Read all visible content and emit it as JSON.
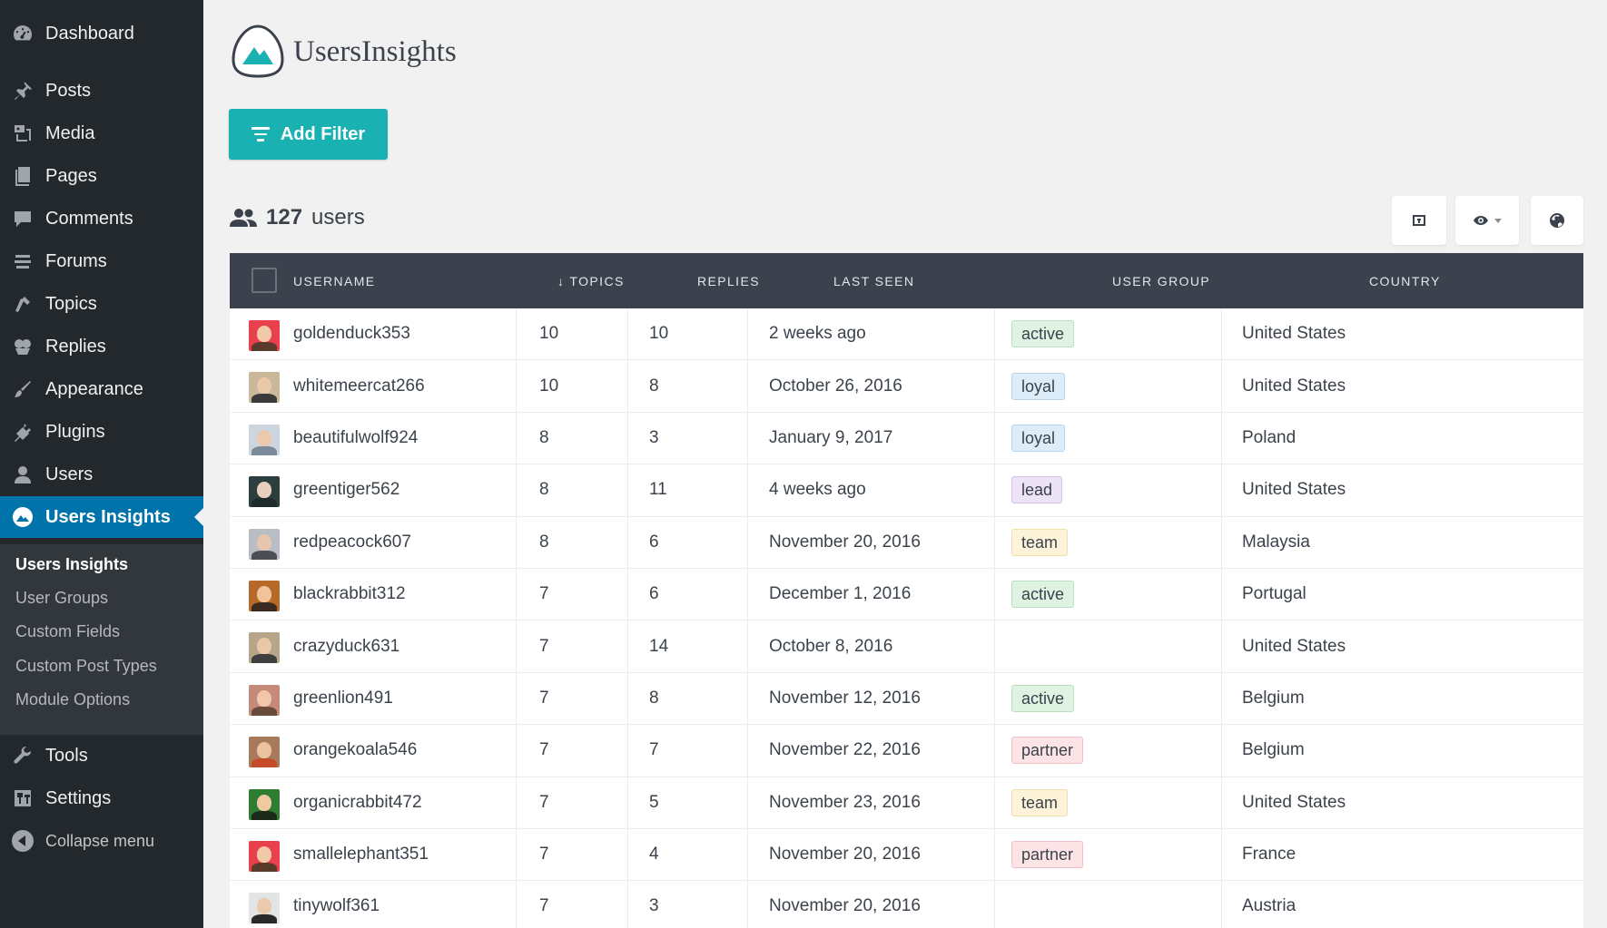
{
  "sidebar": {
    "items": [
      {
        "label": "Dashboard",
        "icon": "dashboard-icon"
      },
      {
        "label": "Posts",
        "icon": "pin-icon"
      },
      {
        "label": "Media",
        "icon": "media-icon"
      },
      {
        "label": "Pages",
        "icon": "pages-icon"
      },
      {
        "label": "Comments",
        "icon": "comment-icon"
      },
      {
        "label": "Forums",
        "icon": "forums-icon"
      },
      {
        "label": "Topics",
        "icon": "topics-icon"
      },
      {
        "label": "Replies",
        "icon": "replies-icon"
      },
      {
        "label": "Appearance",
        "icon": "brush-icon"
      },
      {
        "label": "Plugins",
        "icon": "plug-icon"
      },
      {
        "label": "Users",
        "icon": "user-icon"
      },
      {
        "label": "Users Insights",
        "icon": "mountain-icon"
      },
      {
        "label": "Tools",
        "icon": "wrench-icon"
      },
      {
        "label": "Settings",
        "icon": "settings-icon"
      },
      {
        "label": "Collapse menu",
        "icon": "collapse-icon"
      }
    ],
    "submenu": [
      "Users Insights",
      "User Groups",
      "Custom Fields",
      "Custom Post Types",
      "Module Options"
    ]
  },
  "logo": {
    "text": "UsersInsights"
  },
  "toolbar": {
    "add_filter": "Add Filter",
    "users_count": "127",
    "users_label": "users"
  },
  "table": {
    "headers": [
      "USERNAME",
      "↓ TOPICS",
      "REPLIES",
      "LAST SEEN",
      "USER GROUP",
      "COUNTRY"
    ],
    "rows": [
      {
        "username": "goldenduck353",
        "topics": "10",
        "replies": "10",
        "last_seen": "2 weeks ago",
        "group": "active",
        "country": "United States"
      },
      {
        "username": "whitemeercat266",
        "topics": "10",
        "replies": "8",
        "last_seen": "October 26, 2016",
        "group": "loyal",
        "country": "United States"
      },
      {
        "username": "beautifulwolf924",
        "topics": "8",
        "replies": "3",
        "last_seen": "January 9, 2017",
        "group": "loyal",
        "country": "Poland"
      },
      {
        "username": "greentiger562",
        "topics": "8",
        "replies": "11",
        "last_seen": "4 weeks ago",
        "group": "lead",
        "country": "United States"
      },
      {
        "username": "redpeacock607",
        "topics": "8",
        "replies": "6",
        "last_seen": "November 20, 2016",
        "group": "team",
        "country": "Malaysia"
      },
      {
        "username": "blackrabbit312",
        "topics": "7",
        "replies": "6",
        "last_seen": "December 1, 2016",
        "group": "active",
        "country": "Portugal"
      },
      {
        "username": "crazyduck631",
        "topics": "7",
        "replies": "14",
        "last_seen": "October 8, 2016",
        "group": "",
        "country": "United States"
      },
      {
        "username": "greenlion491",
        "topics": "7",
        "replies": "8",
        "last_seen": "November 12, 2016",
        "group": "active",
        "country": "Belgium"
      },
      {
        "username": "orangekoala546",
        "topics": "7",
        "replies": "7",
        "last_seen": "November 22, 2016",
        "group": "partner",
        "country": "Belgium"
      },
      {
        "username": "organicrabbit472",
        "topics": "7",
        "replies": "5",
        "last_seen": "November 23, 2016",
        "group": "team",
        "country": "United States"
      },
      {
        "username": "smallelephant351",
        "topics": "7",
        "replies": "4",
        "last_seen": "November 20, 2016",
        "group": "partner",
        "country": "France"
      },
      {
        "username": "tinywolf361",
        "topics": "7",
        "replies": "3",
        "last_seen": "November 20, 2016",
        "group": "",
        "country": "Austria"
      }
    ]
  },
  "colors": {
    "accent": "#1ab1b2",
    "sidebar_bg": "#23282d",
    "sidebar_current": "#0073aa",
    "table_header": "#3b424d",
    "badges": {
      "active": {
        "bg": "#dff3e3",
        "border": "#b7dfc0"
      },
      "loyal": {
        "bg": "#dcedf9",
        "border": "#b5d6ee"
      },
      "lead": {
        "bg": "#ece3f7",
        "border": "#d3c2ec"
      },
      "team": {
        "bg": "#fdf3d8",
        "border": "#f0dfa6"
      },
      "partner": {
        "bg": "#fbe3e6",
        "border": "#f1c1c8"
      }
    }
  }
}
